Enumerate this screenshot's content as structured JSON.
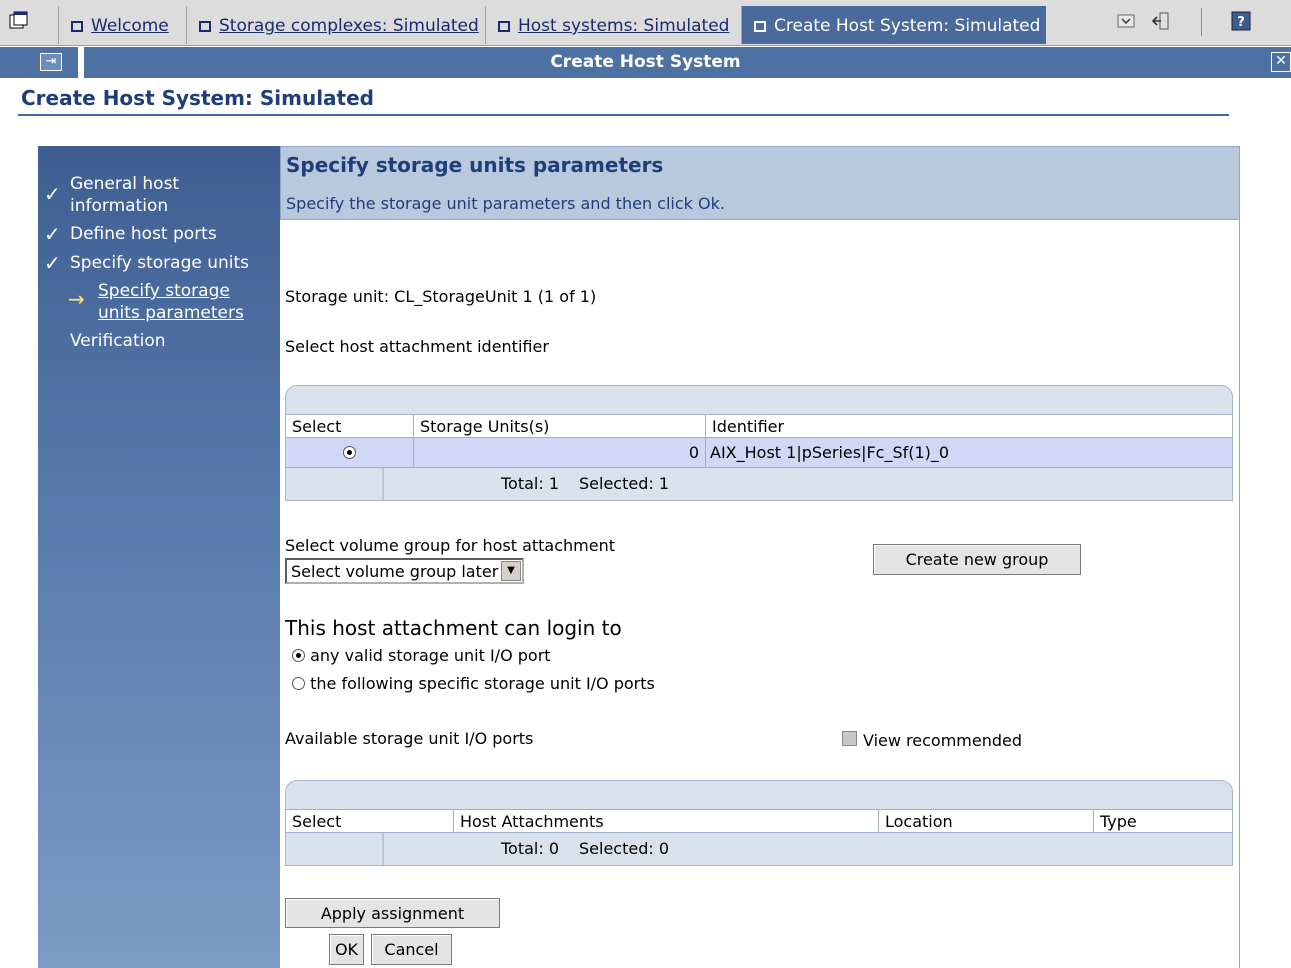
{
  "tabs": [
    {
      "label": "Welcome",
      "active": false
    },
    {
      "label": "Storage complexes: Simulated",
      "active": false
    },
    {
      "label": "Host systems: Simulated",
      "active": false
    },
    {
      "label": "Create Host System: Simulated",
      "active": true
    }
  ],
  "titlebar": {
    "title": "Create Host System"
  },
  "page": {
    "title": "Create Host System: Simulated"
  },
  "nav": {
    "steps": [
      "General host information",
      "Define host ports",
      "Specify storage units"
    ],
    "step1_line1": "General host",
    "step1_line2": "information",
    "substep_line1": "Specify storage",
    "substep_line2": "units parameters",
    "last": "Verification"
  },
  "panel": {
    "heading": "Specify storage units parameters",
    "subtitle": "Specify the storage unit parameters and then click Ok."
  },
  "storage_unit": "Storage unit: CL_StorageUnit 1 (1 of 1)",
  "select_identifier_label": "Select host attachment identifier",
  "table1": {
    "headers": [
      "Select",
      "Storage Units(s)",
      "Identifier"
    ],
    "rows": [
      {
        "selected": true,
        "storage_units": "0",
        "identifier": "AIX_Host 1|pSeries|Fc_Sf(1)_0"
      }
    ],
    "total": "Total: 1",
    "selected": "Selected: 1"
  },
  "volume_group": {
    "label": "Select volume group for host attachment",
    "value": "Select volume group later",
    "create_button": "Create new group"
  },
  "login": {
    "heading": "This host attachment can login to",
    "opt1": "any valid storage unit I/O port",
    "opt2": "the following specific storage unit I/O ports",
    "selected": "opt1"
  },
  "ports": {
    "label": "Available storage unit I/O ports",
    "view_recommended": "View recommended",
    "view_recommended_checked": false
  },
  "table2": {
    "headers": [
      "Select",
      "Host Attachments",
      "Location",
      "Type"
    ],
    "total": "Total: 0",
    "selected": "Selected: 0"
  },
  "buttons": {
    "apply": "Apply assignment",
    "ok": "OK",
    "cancel": "Cancel"
  }
}
